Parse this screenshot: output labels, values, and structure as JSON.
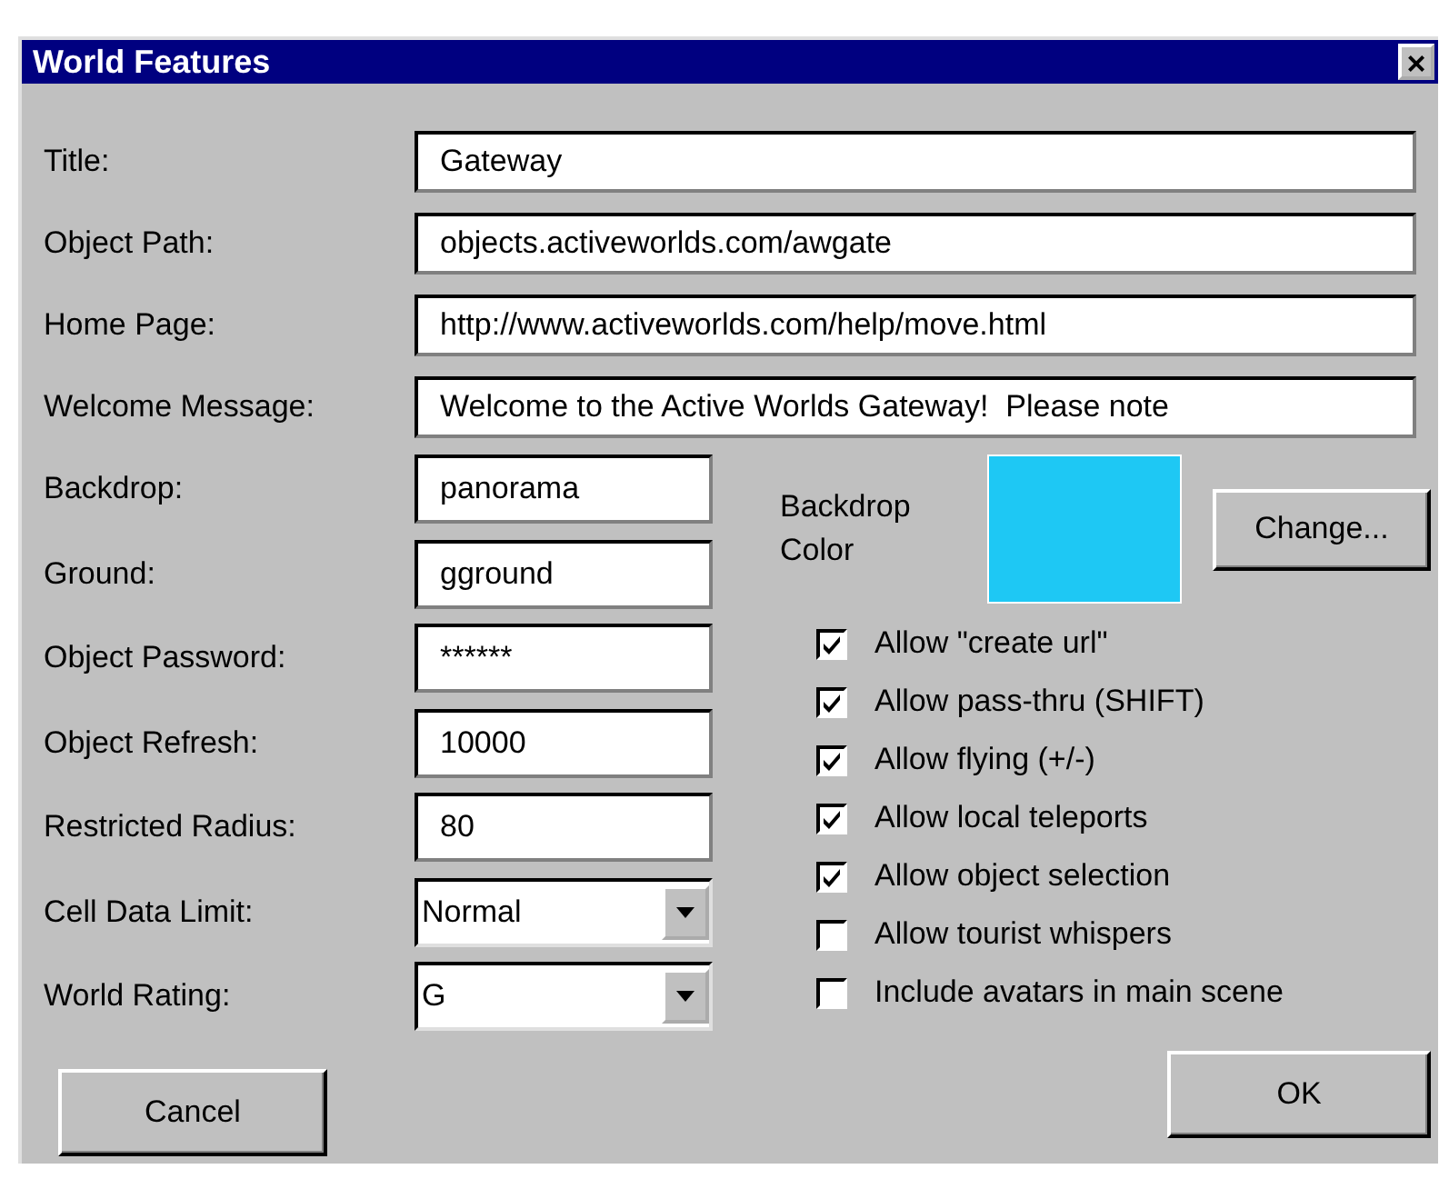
{
  "window": {
    "title": "World Features",
    "close": "×"
  },
  "text_fields": [
    {
      "label": "Title:",
      "value": "Gateway"
    },
    {
      "label": "Object Path:",
      "value": "objects.activeworlds.com/awgate"
    },
    {
      "label": "Home Page:",
      "value": "http://www.activeworlds.com/help/move.html"
    },
    {
      "label": "Welcome Message:",
      "value": "Welcome to the Active Worlds Gateway!  Please note"
    }
  ],
  "settings": [
    {
      "kind": "text",
      "label": "Backdrop:",
      "value": "panorama"
    },
    {
      "kind": "text",
      "label": "Ground:",
      "value": "gground"
    },
    {
      "kind": "text",
      "label": "Object Password:",
      "value": "******"
    },
    {
      "kind": "text",
      "label": "Object Refresh:",
      "value": "10000"
    },
    {
      "kind": "text",
      "label": "Restricted Radius:",
      "value": "80"
    },
    {
      "kind": "dropdown",
      "label": "Cell Data Limit:",
      "value": "Normal"
    },
    {
      "kind": "dropdown",
      "label": "World Rating:",
      "value": "G"
    }
  ],
  "backdrop_color": {
    "label": "Backdrop Color",
    "color": "#1ec8f4",
    "button": "Change..."
  },
  "options": [
    {
      "label": "Allow \"create url\"",
      "checked": true
    },
    {
      "label": "Allow pass-thru (SHIFT)",
      "checked": true
    },
    {
      "label": "Allow flying (+/-)",
      "checked": true
    },
    {
      "label": "Allow local teleports",
      "checked": true
    },
    {
      "label": "Allow object selection",
      "checked": true
    },
    {
      "label": "Allow tourist whispers",
      "checked": false
    },
    {
      "label": "Include avatars in main scene",
      "checked": false
    }
  ],
  "buttons": {
    "cancel": "Cancel",
    "ok": "OK"
  }
}
